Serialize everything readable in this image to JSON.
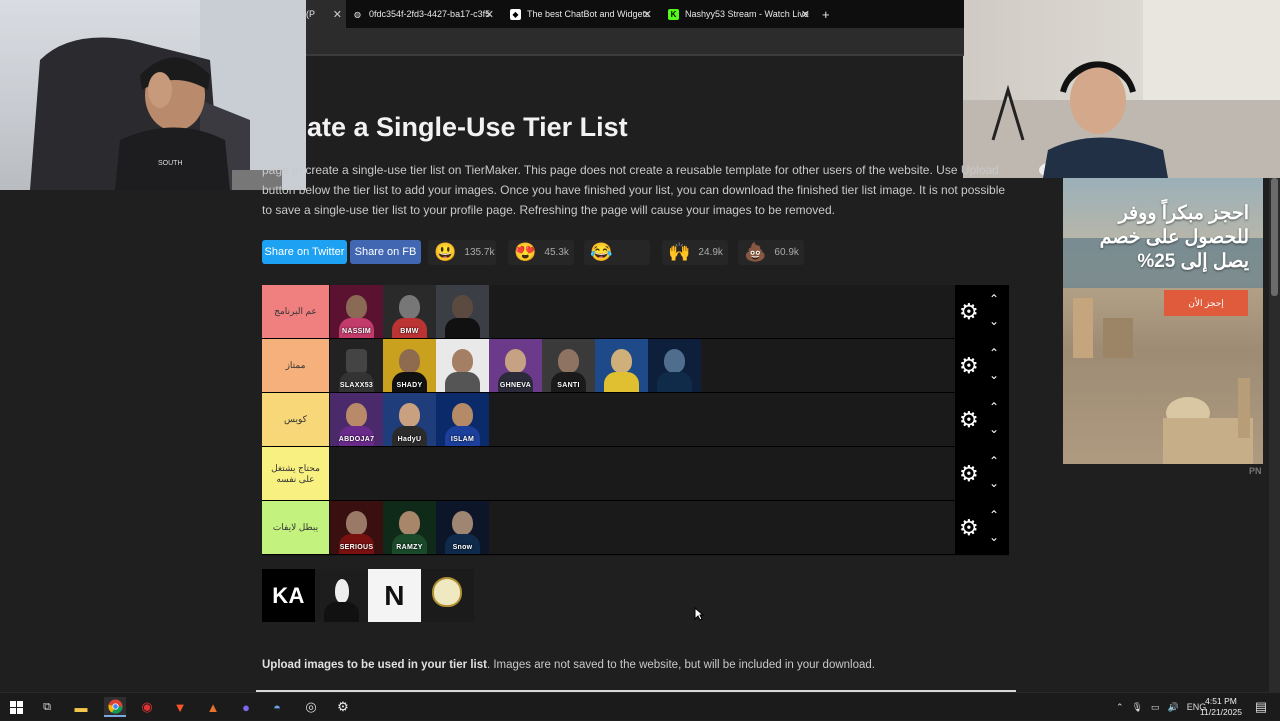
{
  "browser": {
    "tabs": [
      {
        "label": "(P",
        "active": true
      },
      {
        "label": "0fdc354f-2fd3-4427-ba17-c3f5"
      },
      {
        "label": "The best ChatBot and Widgets"
      },
      {
        "label": "Nashyy53 Stream - Watch Live"
      }
    ],
    "new_tab_label": "+",
    "close_glyph": "✕"
  },
  "page": {
    "title": "ate a Single-Use Tier List",
    "intro": "page to create a single-use tier list on TierMaker. This page does not create a reusable template for other users of the website. Use Upload button below the tier list to add your images. Once you have finished your list, you can download the finished tier list image. It is not possible to save a single-use tier list to your profile page. Refreshing the page will cause your images to be removed.",
    "share_twitter": "Share on Twitter",
    "share_fb": "Share on FB",
    "twitter_color": "#1da1f2",
    "fb_color": "#3b5998",
    "reactions": [
      {
        "emoji": "😃",
        "count": "135.7k"
      },
      {
        "emoji": "😍",
        "count": "45.3k"
      },
      {
        "emoji": "😂",
        "count": ""
      },
      {
        "emoji": "🙌",
        "count": "24.9k"
      },
      {
        "emoji": "💩",
        "count": "60.9k"
      }
    ]
  },
  "tiers": [
    {
      "label": "عم البرنامج",
      "color": "#ff7f7f",
      "items": [
        "NASSIM",
        "BMW",
        ""
      ]
    },
    {
      "label": "ممتاز",
      "color": "#ffbf7f",
      "items": [
        "SLAXX53",
        "SHADY",
        "",
        "GHNEVA",
        "SANTI",
        "",
        ""
      ]
    },
    {
      "label": "كويس",
      "color": "#ffdf7f",
      "items": [
        "ABDOJA7",
        "HadyU",
        "ISLAM"
      ]
    },
    {
      "label": "محتاج يشتغل على نفسه",
      "color": "#ffff7f",
      "items": []
    },
    {
      "label": "يبطل لايفات",
      "color": "#bfff7f",
      "items": [
        "SERIOUS",
        "RAMZY",
        "Snow"
      ]
    }
  ],
  "pool": [
    "KA",
    "",
    "N",
    ""
  ],
  "upload": {
    "bold": "Upload images to be used in your tier list",
    "rest": ". Images are not saved to the website, but will be included in your download."
  },
  "ad": {
    "headline": "احجز مبكراً ووفر للحصول على خصم يصل إلى 25%",
    "cta": "إحجز الأن",
    "mark": "PN"
  },
  "taskbar": {
    "lang": "ENG",
    "time": "4:51 PM",
    "date": "11/21/2025"
  }
}
